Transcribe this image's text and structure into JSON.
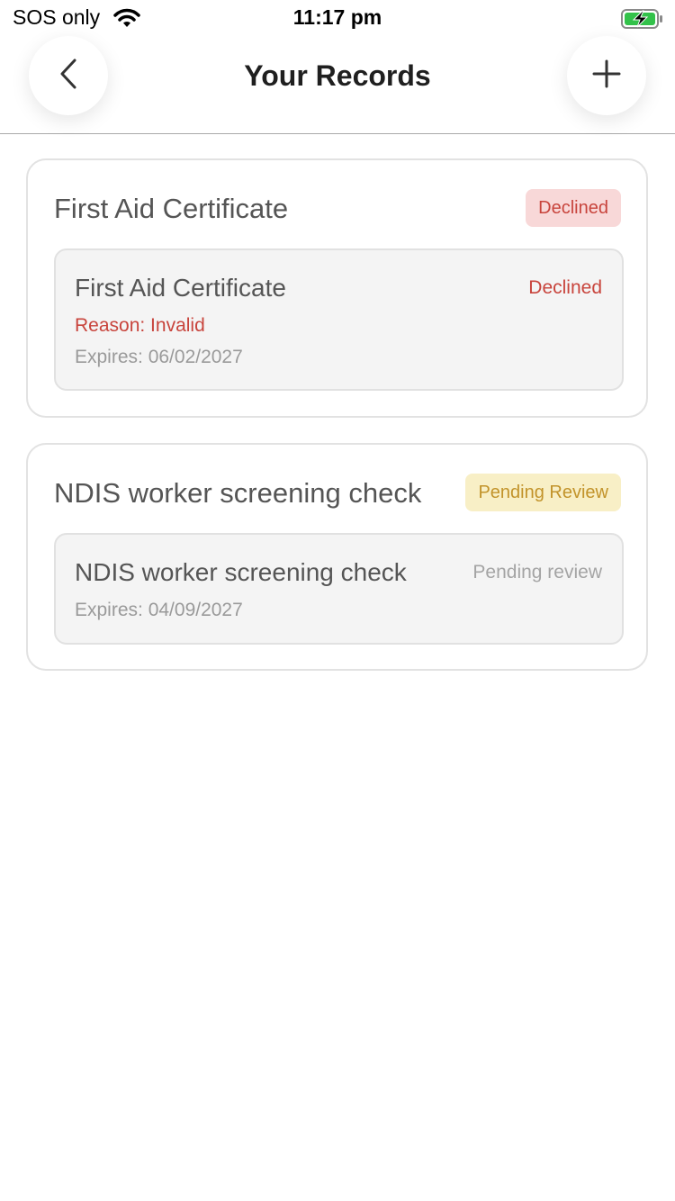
{
  "status_bar": {
    "carrier": "SOS only",
    "time": "11:17 pm",
    "battery_color": "#33c24a"
  },
  "header": {
    "title": "Your Records",
    "back_icon": "chevron-left-icon",
    "add_icon": "plus-icon"
  },
  "records": [
    {
      "title": "First Aid Certificate",
      "badge": "Declined",
      "item": {
        "name": "First Aid Certificate",
        "status": "Declined",
        "reason": "Reason: Invalid",
        "expires": "Expires: 06/02/2027"
      }
    },
    {
      "title": "NDIS worker screening check",
      "badge": "Pending Review",
      "item": {
        "name": "NDIS worker screening check",
        "status": "Pending review",
        "expires": "Expires: 04/09/2027"
      }
    }
  ],
  "colors": {
    "declined": "#c8443c",
    "declined_bg": "#f8d8d8",
    "pending": "#c2932a",
    "pending_bg": "#f8efc6"
  }
}
